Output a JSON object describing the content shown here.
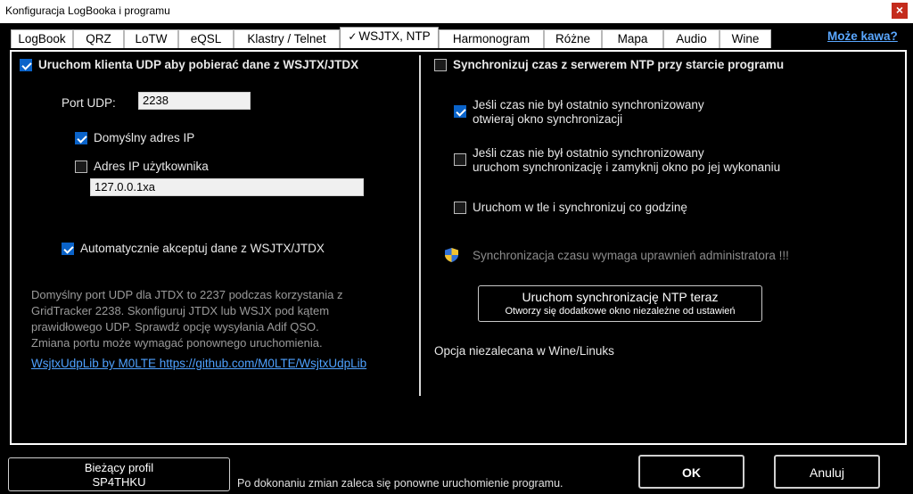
{
  "window": {
    "title": "Konfiguracja LogBooka i programu",
    "close_label": "×"
  },
  "tabs": [
    {
      "label": "LogBook"
    },
    {
      "label": "QRZ"
    },
    {
      "label": "LoTW"
    },
    {
      "label": "eQSL"
    },
    {
      "label": "Klastry / Telnet"
    },
    {
      "label": "WSJTX, NTP",
      "active": true
    },
    {
      "label": "Harmonogram"
    },
    {
      "label": "Różne"
    },
    {
      "label": "Mapa"
    },
    {
      "label": "Audio"
    },
    {
      "label": "Wine"
    }
  ],
  "coffee_link": "Może kawa?",
  "left": {
    "udp_enable": {
      "label": "Uruchom klienta UDP aby pobierać dane z WSJTX/JTDX",
      "checked": true
    },
    "port_label": "Port UDP:",
    "port_value": "2238",
    "default_ip": {
      "label": "Domyślny adres IP",
      "checked": true
    },
    "user_ip": {
      "label": "Adres IP użytkownika",
      "checked": false
    },
    "ip_value": "127.0.0.1xa",
    "auto_accept": {
      "label": "Automatycznie akceptuj dane z WSJTX/JTDX",
      "checked": true
    },
    "info_lines": [
      "Domyślny port UDP dla JTDX to 2237 podczas korzystania z",
      "GridTracker 2238. Skonfiguruj JTDX lub WSJX pod kątem",
      "prawidłowego UDP. Sprawdź opcję wysyłania Adif QSO.",
      "Zmiana portu może wymagać ponownego uruchomienia."
    ],
    "lib_link": "WsjtxUdpLib by M0LTE https://github.com/M0LTE/WsjtxUdpLib"
  },
  "right": {
    "ntp_sync": {
      "label": "Synchronizuj czas z serwerem NTP przy starcie programu",
      "checked": false
    },
    "opt1": {
      "line1": "Jeśli czas nie był ostatnio synchronizowany",
      "line2": "otwieraj okno synchronizacji",
      "checked": true
    },
    "opt2": {
      "line1": "Jeśli czas nie był ostatnio synchronizowany",
      "line2": "uruchom synchronizację i zamyknij okno po jej wykonaniu",
      "checked": false
    },
    "opt3": {
      "label": "Uruchom w tle i synchronizuj co godzinę",
      "checked": false
    },
    "admin_note": "Synchronizacja czasu wymaga uprawnień administratora !!!",
    "ntp_button": {
      "line1": "Uruchom synchronizację NTP teraz",
      "line2": "Otworzy się dodatkowe okno niezależne od ustawień"
    },
    "wine_note": "Opcja niezalecana w Wine/Linuks"
  },
  "footer": {
    "profile_line1": "Bieżący profil",
    "profile_line2": "SP4THKU",
    "restart_note": "Po dokonaniu zmian zaleca się ponowne uruchomienie programu.",
    "ok_label": "OK",
    "cancel_label": "Anuluj"
  },
  "colors": {
    "accent": "#0a63c9",
    "link": "#4ea1ff",
    "close": "#c42b1c"
  }
}
